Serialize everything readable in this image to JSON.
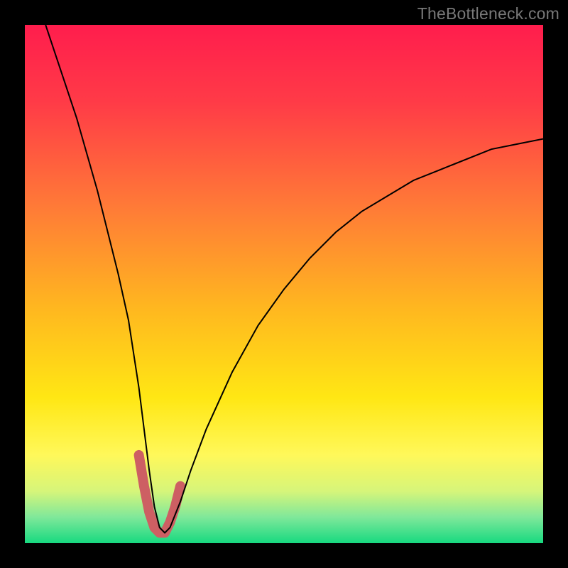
{
  "watermark": "TheBottleneck.com",
  "chart_data": {
    "type": "line",
    "title": "",
    "xlabel": "",
    "ylabel": "",
    "xlim": [
      0,
      100
    ],
    "ylim": [
      0,
      100
    ],
    "series": [
      {
        "name": "bottleneck-curve",
        "color": "#000000",
        "x": [
          4,
          6,
          8,
          10,
          12,
          14,
          16,
          18,
          20,
          22,
          23,
          24,
          25,
          26,
          27,
          28,
          30,
          32,
          35,
          40,
          45,
          50,
          55,
          60,
          65,
          70,
          75,
          80,
          85,
          90,
          95,
          100
        ],
        "y": [
          100,
          94,
          88,
          82,
          75,
          68,
          60,
          52,
          43,
          30,
          22,
          14,
          7,
          3,
          2,
          3,
          8,
          14,
          22,
          33,
          42,
          49,
          55,
          60,
          64,
          67,
          70,
          72,
          74,
          76,
          77,
          78
        ]
      },
      {
        "name": "optimal-region",
        "color": "#cd5f63",
        "x": [
          22,
          23,
          24,
          25,
          26,
          27,
          28,
          29,
          30
        ],
        "y": [
          17,
          11,
          6,
          3,
          2,
          2,
          4,
          7,
          11
        ]
      }
    ],
    "background_gradient": {
      "stops": [
        {
          "pos": 0.0,
          "color": "#ff1d4d"
        },
        {
          "pos": 0.15,
          "color": "#ff3b47"
        },
        {
          "pos": 0.35,
          "color": "#ff7a37"
        },
        {
          "pos": 0.55,
          "color": "#ffb81f"
        },
        {
          "pos": 0.72,
          "color": "#ffe714"
        },
        {
          "pos": 0.83,
          "color": "#fff85a"
        },
        {
          "pos": 0.9,
          "color": "#d6f57a"
        },
        {
          "pos": 0.95,
          "color": "#7fe89a"
        },
        {
          "pos": 1.0,
          "color": "#17d980"
        }
      ]
    },
    "grid": false,
    "legend": false
  }
}
